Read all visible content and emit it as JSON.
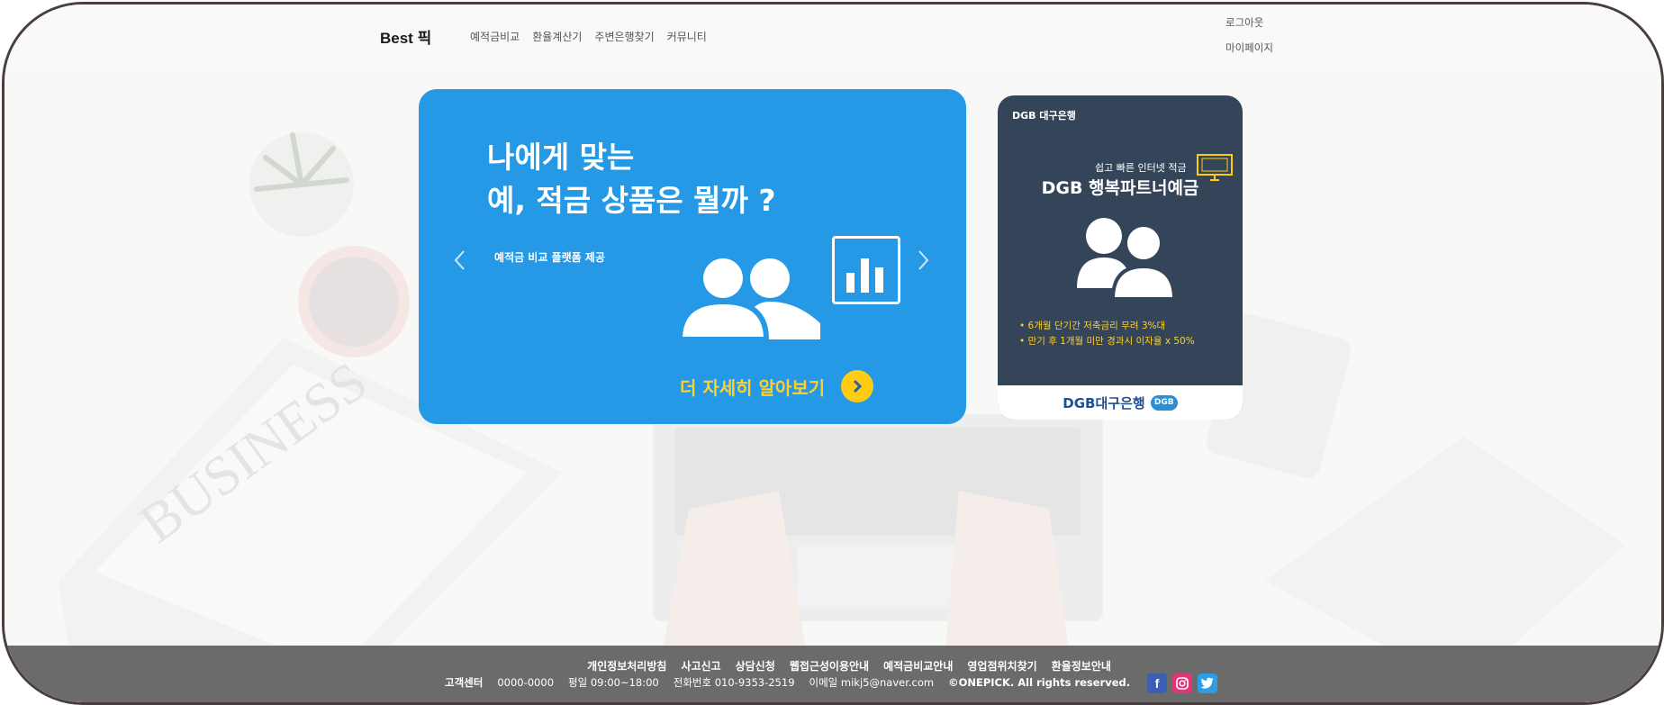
{
  "header": {
    "brand": "Best 픽",
    "nav": [
      "예적금비교",
      "환율계산기",
      "주변은행찾기",
      "커뮤니티"
    ],
    "account": [
      "로그아웃",
      "마이페이지"
    ]
  },
  "hero": {
    "title_line1": "나에게 맞는",
    "title_line2": "예, 적금 상품은 뭘까 ?",
    "subtitle": "예적금 비교 플랫폼 제공",
    "cta": "더 자세히 알아보기"
  },
  "ad": {
    "bank": "DGB 대구은행",
    "tagline": "쉽고 빠른 인터넷 적금",
    "title": "DGB 행복파트너예금",
    "bullets": [
      "6개월 단기간 저축금리 무려 3%대",
      "만기 후 1개월 미만 경과시 이자율 x 50%"
    ],
    "footer_name": "DGB대구은행",
    "badge": "DGB"
  },
  "footer": {
    "links": [
      "개인정보처리방침",
      "사고신고",
      "상담신청",
      "웹접근성이용안내",
      "예적금비교안내",
      "영업점위치찾기",
      "환율정보안내"
    ],
    "center_label": "고객센터",
    "phone": "0000-0000",
    "hours": "평일 09:00~18:00",
    "tel": "전화번호 010-9353-2519",
    "email": "이메일 mikj5@naver.com",
    "copyright": "©ONEPICK. All rights reserved."
  },
  "colors": {
    "hero_bg": "#2699e6",
    "ad_bg": "#34455a",
    "accent_yellow": "#ffcc11",
    "footer_bg": "#6b6b6b"
  }
}
